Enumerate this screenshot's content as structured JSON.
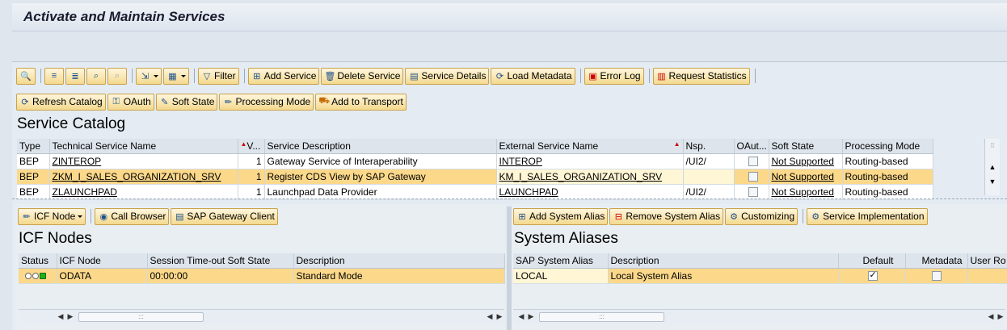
{
  "title": "Activate and Maintain Services",
  "toolbar1": {
    "filter": "Filter",
    "add_service": "Add Service",
    "delete_service": "Delete Service",
    "service_details": "Service Details",
    "load_metadata": "Load Metadata",
    "error_log": "Error Log",
    "request_statistics": "Request Statistics"
  },
  "toolbar2": {
    "refresh_catalog": "Refresh Catalog",
    "oauth": "OAuth",
    "soft_state": "Soft State",
    "processing_mode": "Processing Mode",
    "add_to_transport": "Add to Transport"
  },
  "service_catalog": {
    "title": "Service Catalog",
    "columns": [
      "Type",
      "Technical Service Name",
      "V...",
      "Service Description",
      "External Service Name",
      "Nsp.",
      "OAut...",
      "Soft State",
      "Processing Mode"
    ],
    "rows": [
      {
        "type": "BEP",
        "tech": "ZINTEROP",
        "v": "1",
        "desc": "Gateway Service of Interaperability",
        "ext": "INTEROP",
        "nsp": "/UI2/",
        "soft": "Not Supported",
        "mode": "Routing-based"
      },
      {
        "type": "BEP",
        "tech": "ZKM_I_SALES_ORGANIZATION_SRV",
        "v": "1",
        "desc": "Register CDS View by SAP Gateway",
        "ext": "KM_I_SALES_ORGANIZATION_SRV",
        "nsp": "",
        "soft": "Not Supported",
        "mode": "Routing-based"
      },
      {
        "type": "BEP",
        "tech": "ZLAUNCHPAD",
        "v": "1",
        "desc": "Launchpad Data Provider",
        "ext": "LAUNCHPAD",
        "nsp": "/UI2/",
        "soft": "Not Supported",
        "mode": "Routing-based"
      }
    ]
  },
  "icf": {
    "toolbar": {
      "icf_node": "ICF Node",
      "call_browser": "Call Browser",
      "gateway_client": "SAP Gateway Client"
    },
    "title": "ICF Nodes",
    "columns": [
      "Status",
      "ICF Node",
      "Session Time-out Soft State",
      "Description"
    ],
    "rows": [
      {
        "node": "ODATA",
        "timeout": "00:00:00",
        "desc": "Standard Mode"
      }
    ]
  },
  "aliases": {
    "toolbar": {
      "add": "Add System Alias",
      "remove": "Remove System Alias",
      "customizing": "Customizing",
      "impl": "Service Implementation"
    },
    "title": "System Aliases",
    "columns": [
      "SAP System Alias",
      "Description",
      "Default",
      "Metadata",
      "User Ro"
    ],
    "rows": [
      {
        "alias": "LOCAL",
        "desc": "Local System Alias",
        "default": true,
        "metadata": false
      }
    ]
  },
  "scroll_thumb": ":::"
}
